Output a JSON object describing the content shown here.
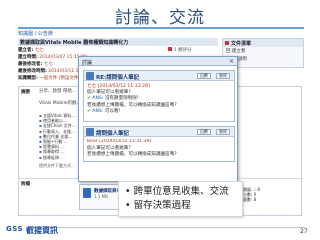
{
  "slide": {
    "title": "討論、交流",
    "page_number": "27"
  },
  "portal": {
    "breadcrumb": "知識園 / 公告牌",
    "doc_title": "數據擷取與Vitals Mobile 翻佈種類知識轉化力",
    "meta": [
      {
        "k": "建立者:",
        "v": "七七"
      },
      {
        "k": "建立時間:",
        "v": "2014/03/07 15:15:09"
      },
      {
        "k": "最後修改者:",
        "v": "七七"
      },
      {
        "k": "最後修改時間:",
        "v": "2014/03/11 17:..."
      },
      {
        "k": "知識類型:",
        "v": "一般文件 (預設文件類型)"
      }
    ],
    "meta_right": "1 觀評分",
    "related_panel": {
      "title": "文件清單",
      "lines": [
        "回 建立者",
        "查 看 說明"
      ]
    },
    "rows": {
      "summary_label": "摘要",
      "summary_text": "分享、啟發 帶給...",
      "vitals_line": "Vitals Mobile的翻...",
      "list_items": [
        "支援Vitals 資料...",
        "使用者能以....",
        "支援Chain 文件...",
        "行動寫入、支援...",
        "數位作業 支援...",
        "智能+行動 ...",
        "智慧資料 ...",
        "搜尋取得 ...",
        "搜尋延伸..."
      ],
      "fine_print": "提供文件下載方式...",
      "attach_label": "附檔"
    },
    "attachment": {
      "filename": "數據擷取與Vitals_Mobile_APP_-_中時電子報.png",
      "size": "1.1 MB",
      "stars": "★★★★★"
    },
    "right_notes": [
      "目前閱讀量...: 8",
      "目前評分數: 0",
      "目前下載數: 8"
    ]
  },
  "popup": {
    "header": "討論",
    "close_glyph": "✕",
    "posts": [
      {
        "title": "RE:請問個人筆記",
        "buttons": [
          "回覆",
          "刪除"
        ],
        "lines": [
          {
            "type": "author",
            "text": "七七 [2014/03/12 11:33:28]"
          },
          {
            "type": "plain",
            "text": "個人筆記可以看幾筆?"
          },
          {
            "type": "ans",
            "label": "ANS",
            "text": "沒有數量限制呢!"
          },
          {
            "type": "plain",
            "text": "若後續想上傳圖檔，可以轉換成知識園區嗎?"
          },
          {
            "type": "ans",
            "label": "ANS",
            "text": "可以喔!"
          }
        ]
      },
      {
        "title": "請問個人筆記",
        "buttons": [
          "回覆",
          "刪除"
        ],
        "lines": [
          {
            "type": "author",
            "text": "Bear [2014/03/12 11:31:39]"
          },
          {
            "type": "plain",
            "text": "個人筆記可以看幾筆?"
          },
          {
            "type": "plain",
            "text": "若後續想上傳圖檔，可以轉換成知識園區嗎?"
          }
        ]
      }
    ]
  },
  "callout": {
    "bullets": [
      "跨單位意見收集、交流",
      "留存決策過程"
    ]
  },
  "footer": {
    "logo_mark": "GSS",
    "logo_name": "叡揚資訊"
  },
  "colors": {
    "title_blue": "#2a4d7a",
    "accent_blue": "#1f5fa8",
    "author_red": "#b03020"
  }
}
